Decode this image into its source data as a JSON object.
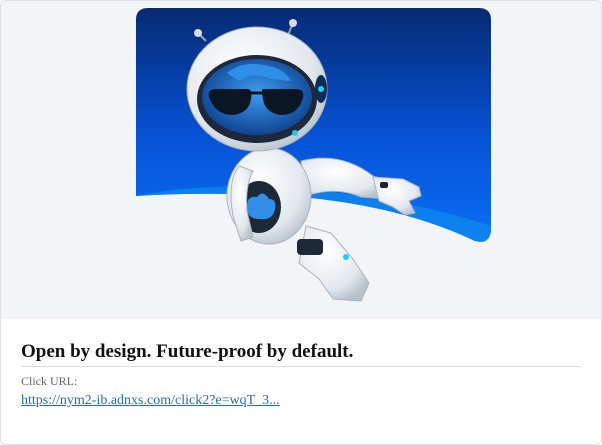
{
  "ad": {
    "image": {
      "icon": "robot-mascot-illustration",
      "colors": {
        "sky_top": "#062a73",
        "sky_bottom": "#0a6ff5",
        "cloud": "#0d8bf0"
      }
    },
    "headline": "Open by design. Future-proof by default.",
    "click_url_label": "Click URL:",
    "click_url": "https://nym2-ib.adnxs.com/click2?e=wqT_3..."
  }
}
